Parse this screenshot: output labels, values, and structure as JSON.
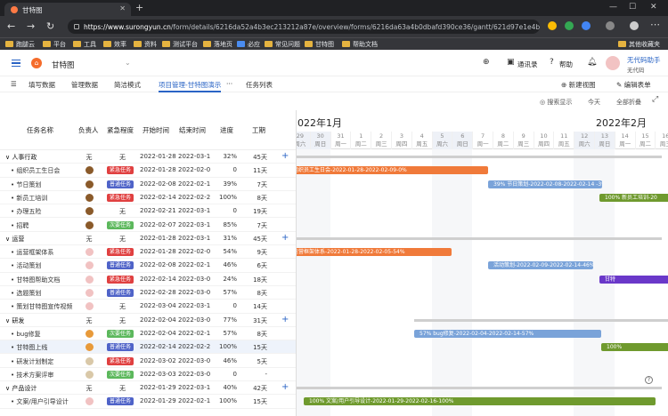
{
  "browser": {
    "tab_title": "甘特图",
    "url_host": "https://www.surongyun.cn",
    "url_path": "/form/details/6216da52a4b3ec213212a87e/overview/forms/6216da63a4b0dbafd390ce36/gantt/621d97e1e4b08c770..."
  },
  "bookmarks": [
    "跑腿云",
    "平台",
    "工具",
    "效率",
    "资料",
    "测试平台",
    "落地页",
    "必应",
    "常见问题",
    "甘特图",
    "帮助文档",
    "其他收藏夹"
  ],
  "header": {
    "title": "甘特图",
    "notice": "通讯录",
    "help": "帮助",
    "user_name": "无代码助手",
    "user_role": "无代码"
  },
  "toolbar": {
    "items": [
      "填写数据",
      "管理数据",
      "简洁模式",
      "项目管理-甘特图演示",
      "···",
      "任务列表"
    ],
    "new_btn": "新建视图",
    "edit_btn": "编辑表单"
  },
  "subtoolbar": {
    "search": "搜索显示",
    "today": "今天",
    "collapse": "全部折叠"
  },
  "grid": {
    "headers": [
      "任务名称",
      "负责人",
      "紧急程度",
      "开始时间",
      "结束时间",
      "进度",
      "工期"
    ],
    "rows": [
      {
        "name": "∨ 人事行政",
        "owner": "无",
        "urg": "无",
        "start": "2022-01-28",
        "end": "2022-03-1",
        "prog": "32%",
        "dur": "45天",
        "group": true
      },
      {
        "name": "• 组织员工生日会",
        "owner": "face",
        "urg": "紧急任务",
        "start": "2022-01-28",
        "end": "2022-02-0",
        "prog": "0",
        "dur": "11天"
      },
      {
        "name": "• 节日策划",
        "owner": "face",
        "urg": "普通任务",
        "start": "2022-02-08",
        "end": "2022-02-1",
        "prog": "39%",
        "dur": "7天"
      },
      {
        "name": "• 新员工培训",
        "owner": "face",
        "urg": "紧急任务",
        "start": "2022-02-14",
        "end": "2022-02-2",
        "prog": "100%",
        "dur": "8天"
      },
      {
        "name": "• 办理五险",
        "owner": "face",
        "urg": "无",
        "start": "2022-02-21",
        "end": "2022-03-1",
        "prog": "0",
        "dur": "19天"
      },
      {
        "name": "• 招聘",
        "owner": "face",
        "urg": "次要任务",
        "start": "2022-02-07",
        "end": "2022-03-1",
        "prog": "85%",
        "dur": "7天"
      },
      {
        "name": "∨ 运营",
        "owner": "无",
        "urg": "无",
        "start": "2022-01-28",
        "end": "2022-03-1",
        "prog": "31%",
        "dur": "45天",
        "group": true
      },
      {
        "name": "• 运营框架体系",
        "owner": "pink",
        "urg": "紧急任务",
        "start": "2022-01-28",
        "end": "2022-02-0",
        "prog": "54%",
        "dur": "9天"
      },
      {
        "name": "• 活动策划",
        "owner": "pink",
        "urg": "普通任务",
        "start": "2022-02-08",
        "end": "2022-02-1",
        "prog": "46%",
        "dur": "6天"
      },
      {
        "name": "• 甘特图帮助文档",
        "owner": "pink",
        "urg": "紧急任务",
        "start": "2022-02-14",
        "end": "2022-03-0",
        "prog": "24%",
        "dur": "18天"
      },
      {
        "name": "• 选题策划",
        "owner": "pink",
        "urg": "普通任务",
        "start": "2022-02-28",
        "end": "2022-03-0",
        "prog": "57%",
        "dur": "8天"
      },
      {
        "name": "• 策划甘特图宣传视频",
        "owner": "pink",
        "urg": "无",
        "start": "2022-03-04",
        "end": "2022-03-1",
        "prog": "0",
        "dur": "14天"
      },
      {
        "name": "∨ 研发",
        "owner": "无",
        "urg": "无",
        "start": "2022-02-04",
        "end": "2022-03-0",
        "prog": "77%",
        "dur": "31天",
        "group": true
      },
      {
        "name": "• bug修复",
        "owner": "tiger",
        "urg": "次要任务",
        "start": "2022-02-04",
        "end": "2022-02-1",
        "prog": "57%",
        "dur": "8天"
      },
      {
        "name": "• 甘特图上线",
        "owner": "tiger",
        "urg": "普通任务",
        "start": "2022-02-14",
        "end": "2022-02-2",
        "prog": "100%",
        "dur": "15天"
      },
      {
        "name": "• 研发计划制定",
        "owner": "light",
        "urg": "紧急任务",
        "start": "2022-03-02",
        "end": "2022-03-0",
        "prog": "46%",
        "dur": "5天"
      },
      {
        "name": "• 技术方案评审",
        "owner": "light",
        "urg": "次要任务",
        "start": "2022-03-03",
        "end": "2022-03-0",
        "prog": "0",
        "dur": "-"
      },
      {
        "name": "∨ 产品设计",
        "owner": "无",
        "urg": "无",
        "start": "2022-01-29",
        "end": "2022-03-1",
        "prog": "40%",
        "dur": "42天",
        "group": true
      },
      {
        "name": "• 文案/用户引导设计",
        "owner": "pink",
        "urg": "普通任务",
        "start": "2022-01-29",
        "end": "2022-02-1",
        "prog": "100%",
        "dur": "15天"
      }
    ]
  },
  "gantt": {
    "month1": "2022年1月",
    "month2": "2022年2月",
    "days": [
      {
        "d": "29",
        "w": "周六"
      },
      {
        "d": "30",
        "w": "周日"
      },
      {
        "d": "31",
        "w": "周一"
      },
      {
        "d": "1",
        "w": "周二"
      },
      {
        "d": "2",
        "w": "周三"
      },
      {
        "d": "3",
        "w": "周四"
      },
      {
        "d": "4",
        "w": "周五"
      },
      {
        "d": "5",
        "w": "周六"
      },
      {
        "d": "6",
        "w": "周日"
      },
      {
        "d": "7",
        "w": "周一"
      },
      {
        "d": "8",
        "w": "周二"
      },
      {
        "d": "9",
        "w": "周三"
      },
      {
        "d": "10",
        "w": "周四"
      },
      {
        "d": "11",
        "w": "周五"
      },
      {
        "d": "12",
        "w": "周六"
      },
      {
        "d": "13",
        "w": "周日"
      },
      {
        "d": "14",
        "w": "周一"
      },
      {
        "d": "15",
        "w": "周二"
      },
      {
        "d": "16",
        "w": "周三"
      }
    ],
    "bars": {
      "b1": "组织员工生日会-2022-01-28-2022-02-09-0%",
      "b2": "39%  节日策划-2022-02-08-2022-02-14  -39%",
      "b3": "100% 新员工培训-20",
      "b4": "运营框架体系-2022-01-28-2022-02-05-54%",
      "b5": "活动策划-2022-02-09-2022-02-14-46%",
      "b6": "甘特",
      "b7": "57%          bug修复-2022-02-04-2022-02-14-57%",
      "b8": "100%",
      "b9": "100%                  文案/用户引导设计-2022-01-29-2022-02-16-100%"
    }
  }
}
